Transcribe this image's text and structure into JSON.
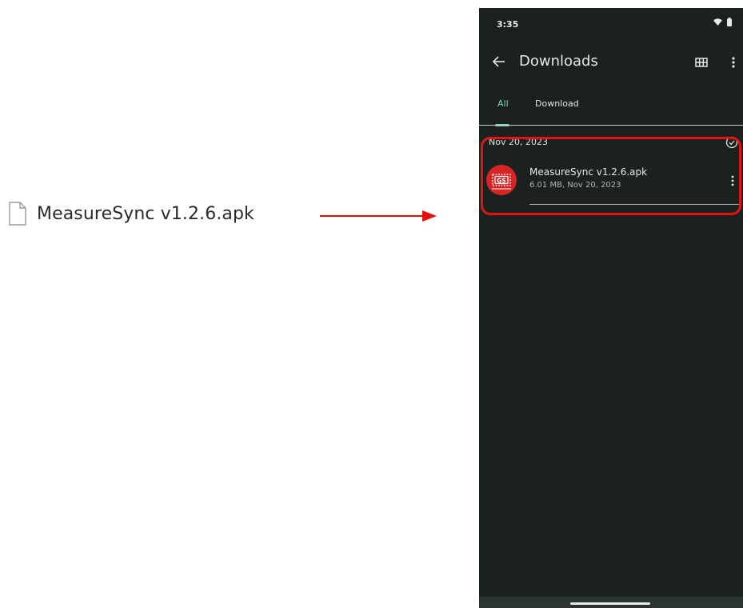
{
  "desktop": {
    "file_name": "MeasureSync v1.2.6.apk"
  },
  "phone": {
    "status_bar": {
      "time": "3:35",
      "icons": [
        "wifi-icon",
        "battery-icon"
      ]
    },
    "app_bar": {
      "title": "Downloads",
      "back_icon": "arrow-back-icon",
      "actions": [
        "grid-view-icon",
        "more-vert-icon"
      ]
    },
    "tabs": [
      {
        "label": "All",
        "active": true
      },
      {
        "label": "Download",
        "active": false
      }
    ],
    "group": {
      "date": "Nov 20, 2023",
      "select_icon": "check-circle-icon",
      "items": [
        {
          "title": "MeasureSync v1.2.6.apk",
          "meta": "6.01 MB, Nov 20, 2023",
          "icon": "app-icon",
          "icon_text": "GS"
        }
      ]
    }
  },
  "colors": {
    "phone_bg": "#1b211f",
    "accent": "#7dd6b7",
    "highlight": "#e11414",
    "app_icon_red": "#d72424"
  }
}
